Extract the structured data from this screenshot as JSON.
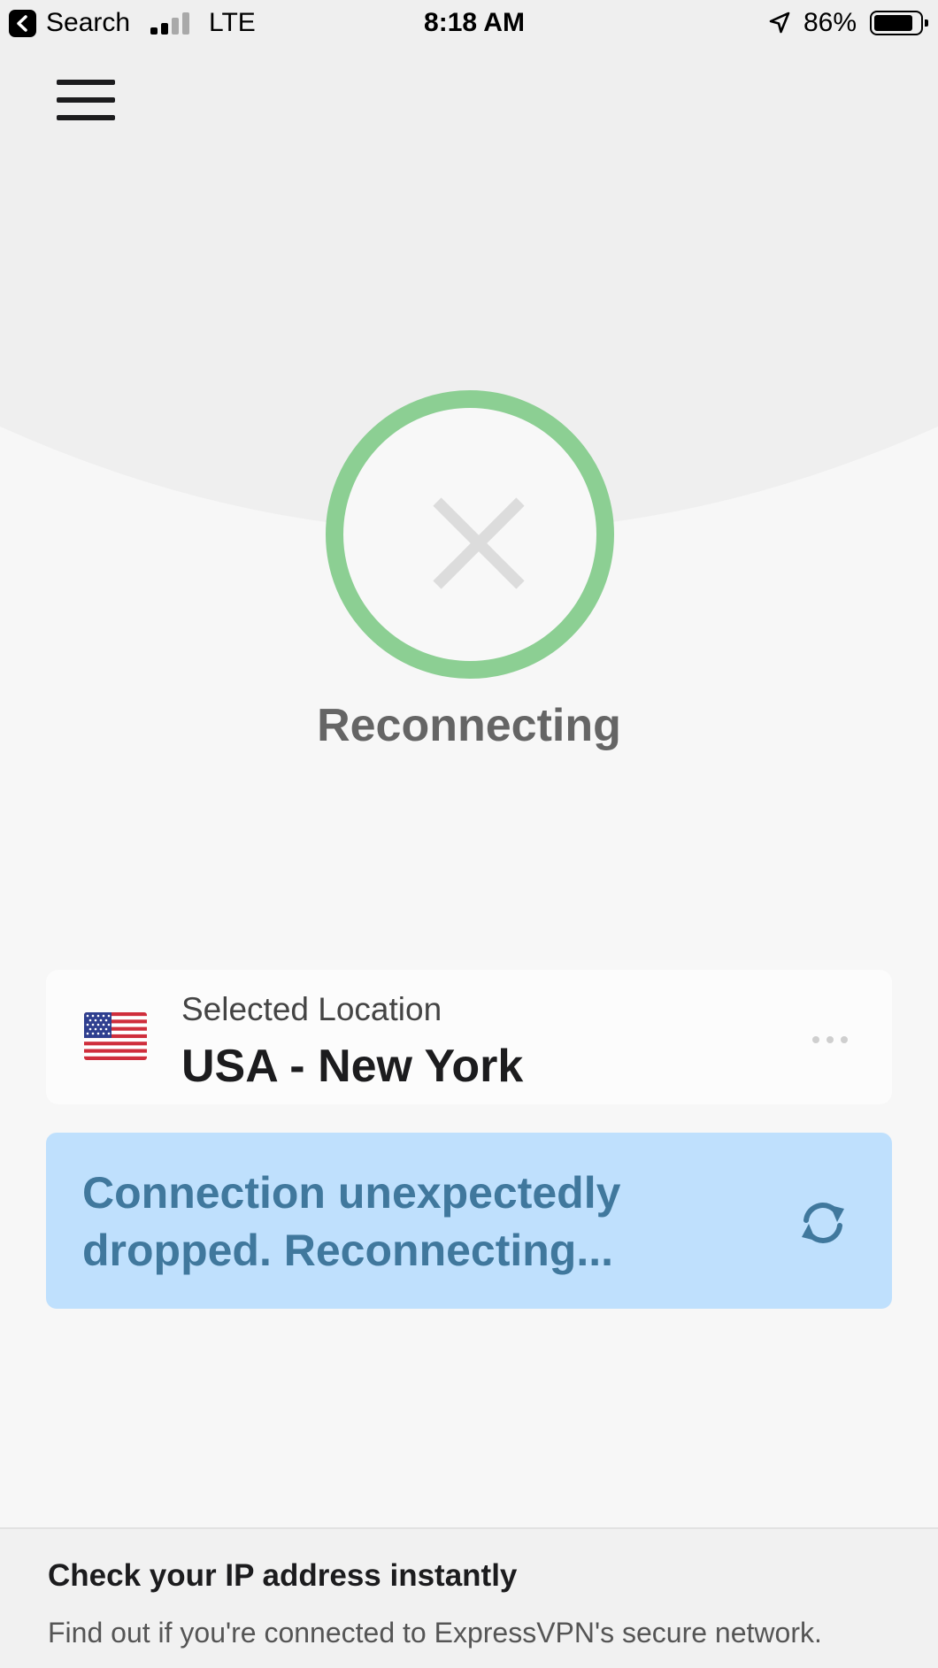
{
  "status_bar": {
    "back_app": "Search",
    "network": "LTE",
    "time": "8:18 AM",
    "battery": "86%",
    "battery_level": 0.86,
    "signal_bars": 4,
    "signal_bars_filled": 2
  },
  "header": {
    "menu_icon": "hamburger-menu-icon"
  },
  "connect": {
    "status": "Reconnecting",
    "icon": "close-x-icon",
    "ring_color": "#8ccf93"
  },
  "location": {
    "caption": "Selected Location",
    "name": "USA - New York",
    "flag_icon": "us-flag-icon",
    "more_icon": "more-dots-icon"
  },
  "notice": {
    "message": "Connection unexpectedly dropped. Reconnecting...",
    "icon": "refresh-icon",
    "background": "#bfe0fd",
    "text_color": "#40789d"
  },
  "ip_check": {
    "title": "Check your IP address instantly",
    "subtitle": "Find out if you're connected to ExpressVPN's secure network."
  }
}
